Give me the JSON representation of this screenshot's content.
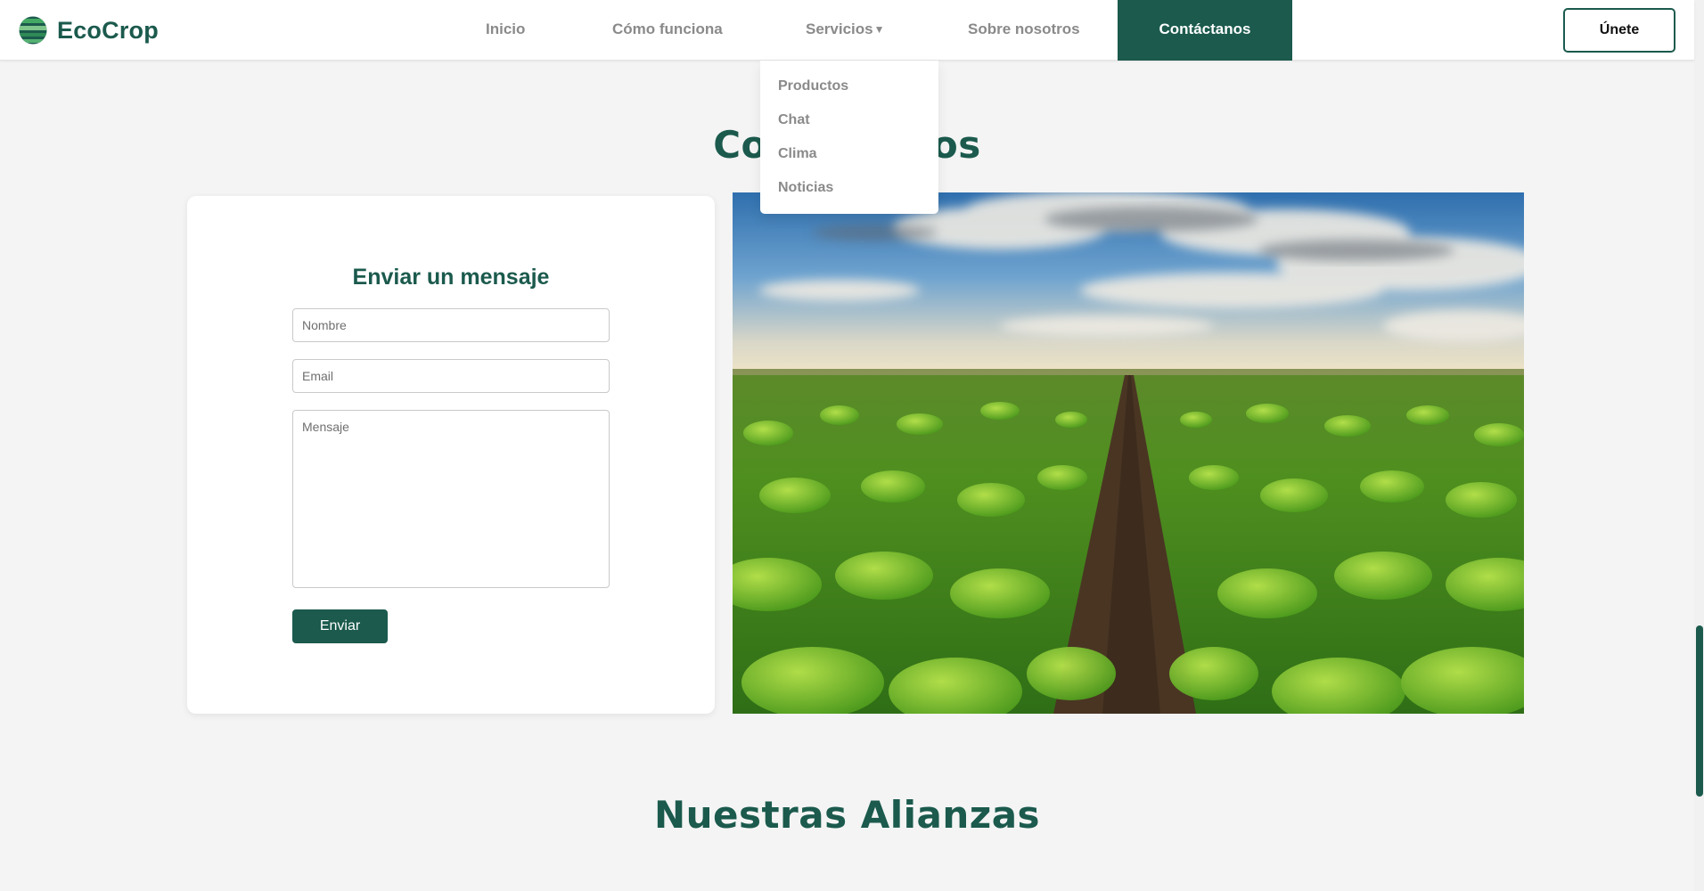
{
  "brand": {
    "name": "EcoCrop",
    "logo_icon": "globe-stripes-icon",
    "color": "#1b5a4d"
  },
  "nav": {
    "items": [
      "Inicio",
      "Cómo funciona",
      "Servicios",
      "Sobre nosotros"
    ],
    "servicios_caret_icon": "caret-down-icon",
    "contact": "Contáctanos",
    "join": "Únete"
  },
  "dropdown": {
    "items": [
      "Productos",
      "Chat",
      "Clima",
      "Noticias"
    ]
  },
  "contact_section": {
    "title": "Contáctanos",
    "form": {
      "title": "Enviar un mensaje",
      "name_placeholder": "Nombre",
      "email_placeholder": "Email",
      "message_placeholder": "Mensaje",
      "submit": "Enviar"
    },
    "image": "green-crop-field-photo"
  },
  "alliances": {
    "title": "Nuestras Alianzas"
  },
  "colors": {
    "accent": "#1b5a4d",
    "background": "#f4f4f4",
    "muted_text": "#8a8a8a"
  }
}
